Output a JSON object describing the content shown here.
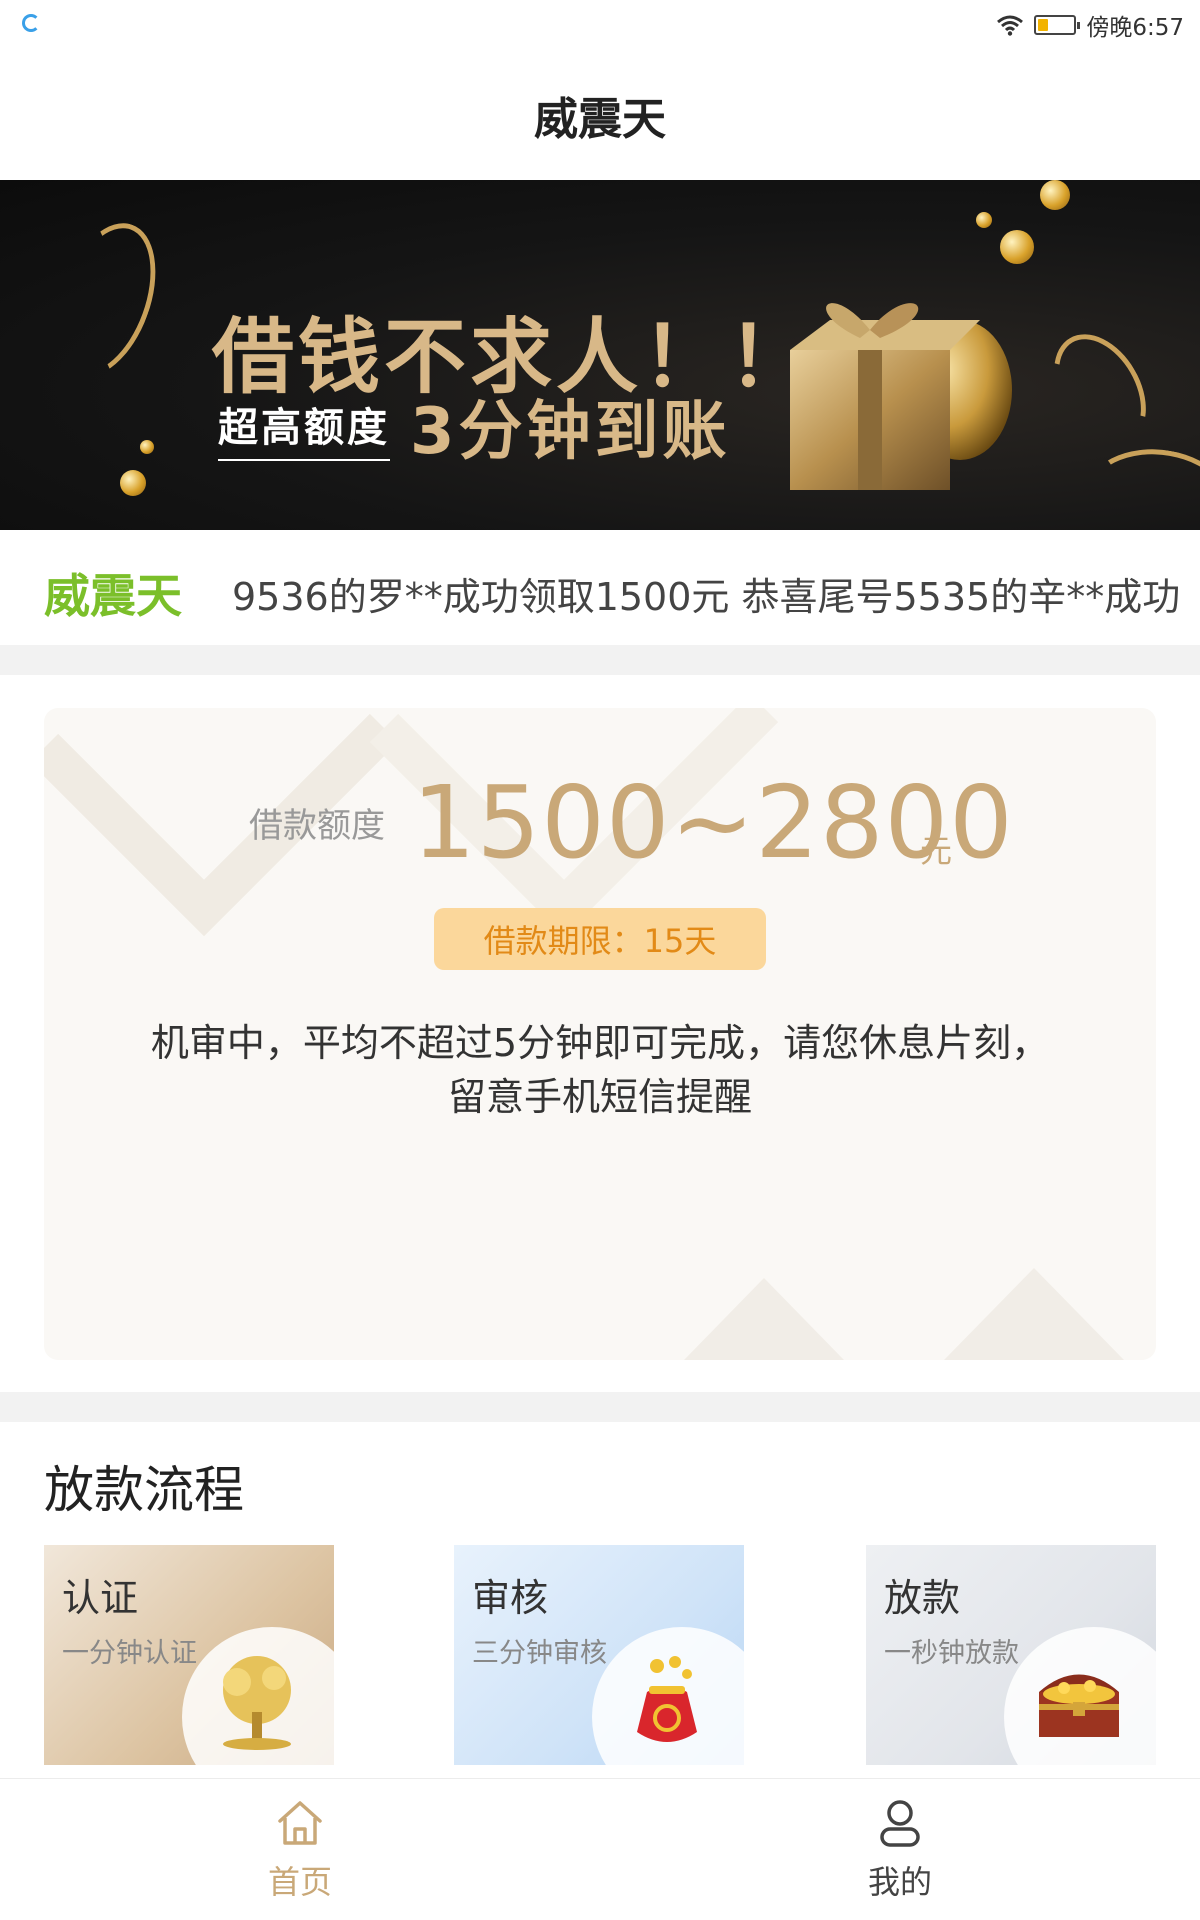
{
  "status_bar": {
    "time": "傍晚6:57",
    "battery_level": 0.25
  },
  "header": {
    "title": "威震天"
  },
  "banner": {
    "headline": "借钱不求人！！",
    "tag": "超高额度",
    "subline": "3分钟到账"
  },
  "ticker": {
    "brand": "威震天",
    "message": "9536的罗**成功领取1500元 恭喜尾号5535的辛**成功"
  },
  "loan_card": {
    "amount_label": "借款额度",
    "amount_range": "1500~2800",
    "amount_unit": "元",
    "term": "借款期限：15天",
    "notice": "机审中，平均不超过5分钟即可完成，请您休息片刻，留意手机短信提醒"
  },
  "process": {
    "title": "放款流程",
    "steps": [
      {
        "title": "认证",
        "subtitle": "一分钟认证",
        "icon": "money-tree-icon"
      },
      {
        "title": "审核",
        "subtitle": "三分钟审核",
        "icon": "money-bag-icon"
      },
      {
        "title": "放款",
        "subtitle": "一秒钟放款",
        "icon": "treasure-chest-icon"
      }
    ]
  },
  "bottom_nav": {
    "items": [
      {
        "label": "首页",
        "icon": "home-icon",
        "active": true
      },
      {
        "label": "我的",
        "icon": "user-icon",
        "active": false
      }
    ]
  },
  "colors": {
    "accent_gold": "#c9a878",
    "brand_green": "#7bbf2a",
    "term_pill_bg": "#fbd79b",
    "term_pill_text": "#e28a17"
  }
}
